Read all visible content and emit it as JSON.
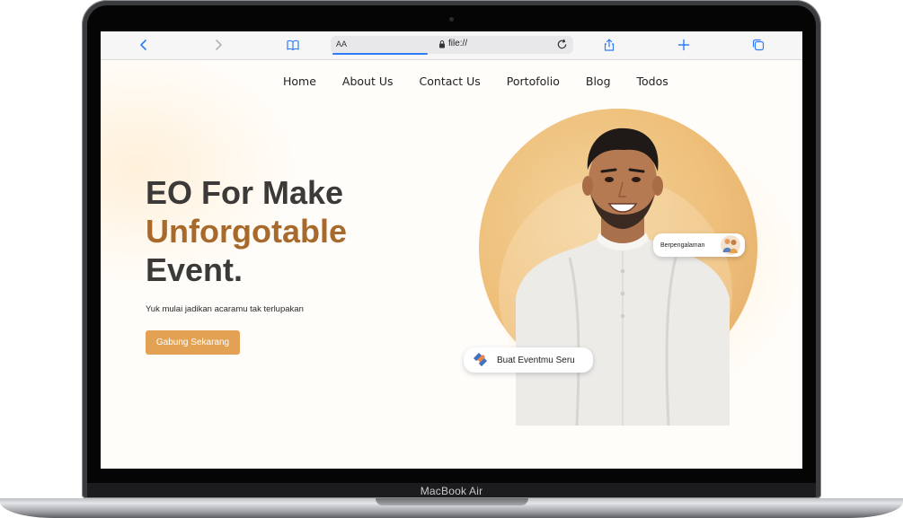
{
  "device": {
    "brand_label": "MacBook Air"
  },
  "browser": {
    "address_aa": "AA",
    "url": "file://",
    "icons": [
      "back-icon",
      "forward-icon",
      "book-icon",
      "lock-icon",
      "reload-icon",
      "share-icon",
      "plus-icon",
      "tabs-icon"
    ]
  },
  "nav": {
    "items": [
      {
        "label": "Home"
      },
      {
        "label": "About Us"
      },
      {
        "label": "Contact Us"
      },
      {
        "label": "Portofolio"
      },
      {
        "label": "Blog"
      },
      {
        "label": "Todos"
      }
    ]
  },
  "hero": {
    "title_line1": "EO For Make",
    "title_accent": "Unforgotable",
    "title_line3": "Event.",
    "subtitle": "Yuk mulai jadikan acaramu tak terlupakan",
    "cta_label": "Gabung Sekarang"
  },
  "badges": {
    "experienced": "Berpengalaman",
    "create_event": "Buat Eventmu Seru"
  },
  "colors": {
    "accent": "#a86a2c",
    "button": "#e3a253",
    "circle": "#eebf79",
    "link": "#2f7cf6"
  }
}
